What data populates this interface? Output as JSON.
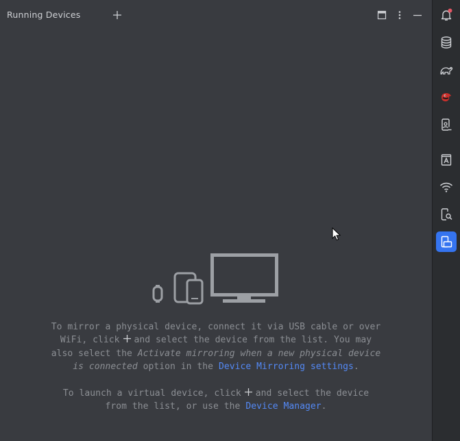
{
  "window": {
    "title": "Running Devices"
  },
  "header": {
    "add_icon": "plus-icon",
    "maximize_icon": "maximize-icon",
    "options_icon": "vertical-ellipsis-icon",
    "minimize_icon": "minimize-icon"
  },
  "sidebar": {
    "items": [
      {
        "icon": "notifications-icon",
        "badge": true
      },
      {
        "icon": "database-icon"
      },
      {
        "icon": "gradle-elephant-icon"
      },
      {
        "icon": "red-bird-plugin-icon"
      },
      {
        "icon": "device-explorer-icon"
      },
      {
        "icon": "logcat-icon"
      },
      {
        "icon": "wifi-icon"
      },
      {
        "icon": "device-inspector-icon"
      },
      {
        "icon": "running-devices-icon",
        "active": true
      }
    ]
  },
  "empty_state": {
    "p1_a": "To mirror a physical device, connect it via USB cable or over",
    "p1_b_1": "WiFi, click",
    "p1_b_2": "and select the device from the list. You may",
    "p1_c_1": "also select the",
    "p1_c_italic": "Activate mirroring when a new physical device",
    "p1_d_italic": "is connected",
    "p1_d_2": "option in the",
    "p1_link": "Device Mirroring settings",
    "p1_end": ".",
    "p2_a_1": "To launch a virtual device, click",
    "p2_a_2": "and select the device",
    "p2_b_1": "from the list, or use the",
    "p2_link": "Device Manager",
    "p2_end": "."
  },
  "colors": {
    "background": "#393b40",
    "sidebar": "#2b2d30",
    "accent": "#3574f0",
    "link": "#548af7",
    "text": "#8c8f94",
    "illustration": "#9da0a5",
    "badge": "#e55765"
  }
}
